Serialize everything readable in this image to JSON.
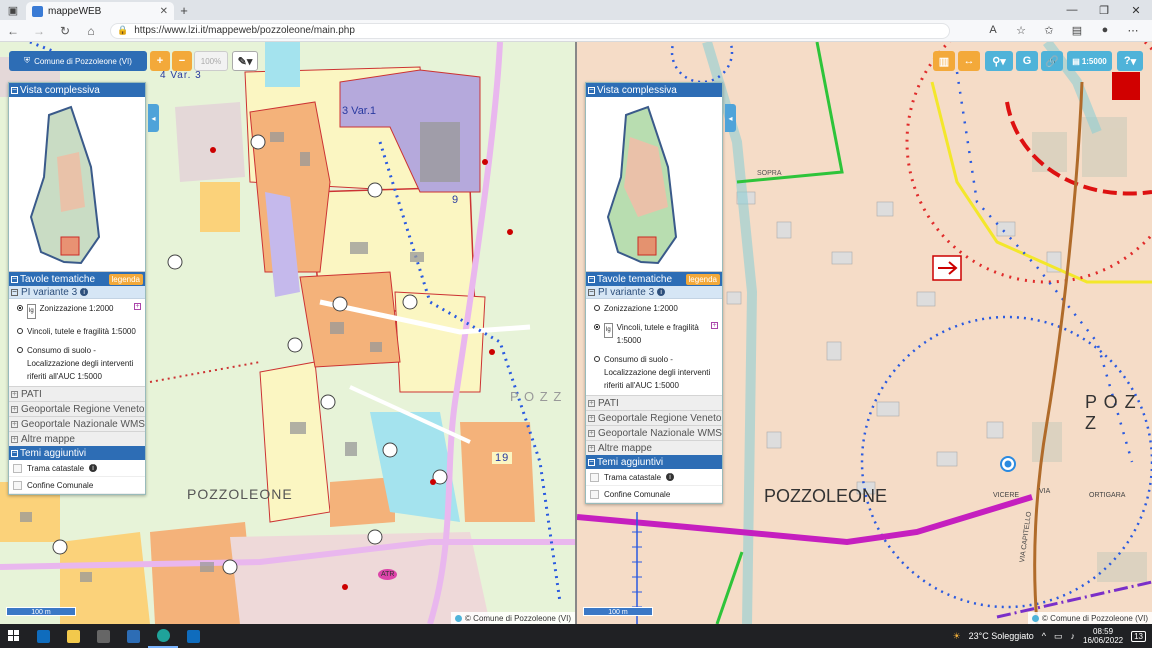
{
  "browser": {
    "tab_title": "mappeWEB",
    "url": "https://www.lzi.it/mappeweb/pozzoleone/main.php"
  },
  "left_pane": {
    "comune_button": "Comune di Pozzoleone (VI)",
    "zoom_in": "+",
    "zoom_out": "−",
    "zoom_level": "100%",
    "map_labels": {
      "var3": "4 Var. 3",
      "var1": "3 Var.1",
      "num9": "9",
      "num19": "19",
      "town": "POZZOLEONE",
      "pozz": "P O Z Z",
      "atr": "ATR"
    },
    "sidebar": {
      "vista": "Vista complessiva",
      "tavole": "Tavole tematiche",
      "legenda": "legenda",
      "pi": "PI variante 3",
      "items": [
        "Zonizzazione 1:2000",
        "Vincoli, tutele e fragilità 1:5000",
        "Consumo di suolo - Localizzazione degli interventi riferiti all'AUC 1:5000"
      ],
      "lg": "lg",
      "groups": [
        "PATI",
        "Geoportale Regione Veneto",
        "Geoportale Nazionale WMS",
        "Altre mappe"
      ],
      "temi": "Temi aggiuntivi",
      "checks": [
        "Trama catastale",
        "Confine Comunale"
      ]
    },
    "scale_bar": "100 m",
    "attribution": "© Comune di Pozzoleone (VI)"
  },
  "right_pane": {
    "scale_button": "1:5000",
    "help_button": "?",
    "map_labels": {
      "sopra": "SOPRA",
      "town": "POZZOLEONE",
      "pozz": "P O Z Z",
      "vicere": "VICERE",
      "via": "VIA",
      "ortigara": "ORTIGARA",
      "capitello": "VIA CAPITELLO"
    },
    "sidebar": {
      "vista": "Vista complessiva",
      "tavole": "Tavole tematiche",
      "legenda": "legenda",
      "pi": "PI variante 3",
      "items": [
        "Zonizzazione 1:2000",
        "Vincoli, tutele e fragilità 1:5000",
        "Consumo di suolo - Localizzazione degli interventi riferiti all'AUC 1:5000"
      ],
      "lg": "lg",
      "groups": [
        "PATI",
        "Geoportale Regione Veneto",
        "Geoportale Nazionale WMS",
        "Altre mappe"
      ],
      "temi": "Temi aggiuntivi",
      "checks": [
        "Trama catastale",
        "Confine Comunale"
      ]
    },
    "scale_bar": "100 m",
    "attribution": "© Comune di Pozzoleone (VI)"
  },
  "taskbar": {
    "weather": "23°C  Soleggiato",
    "time": "08:59",
    "date": "16/06/2022",
    "notif": "13"
  },
  "icons": {
    "taskbar": [
      "windows-start-icon",
      "outlook-icon",
      "file-explorer-icon",
      "calculator-icon",
      "calendar-icon",
      "edge-icon",
      "outlook-icon"
    ]
  }
}
